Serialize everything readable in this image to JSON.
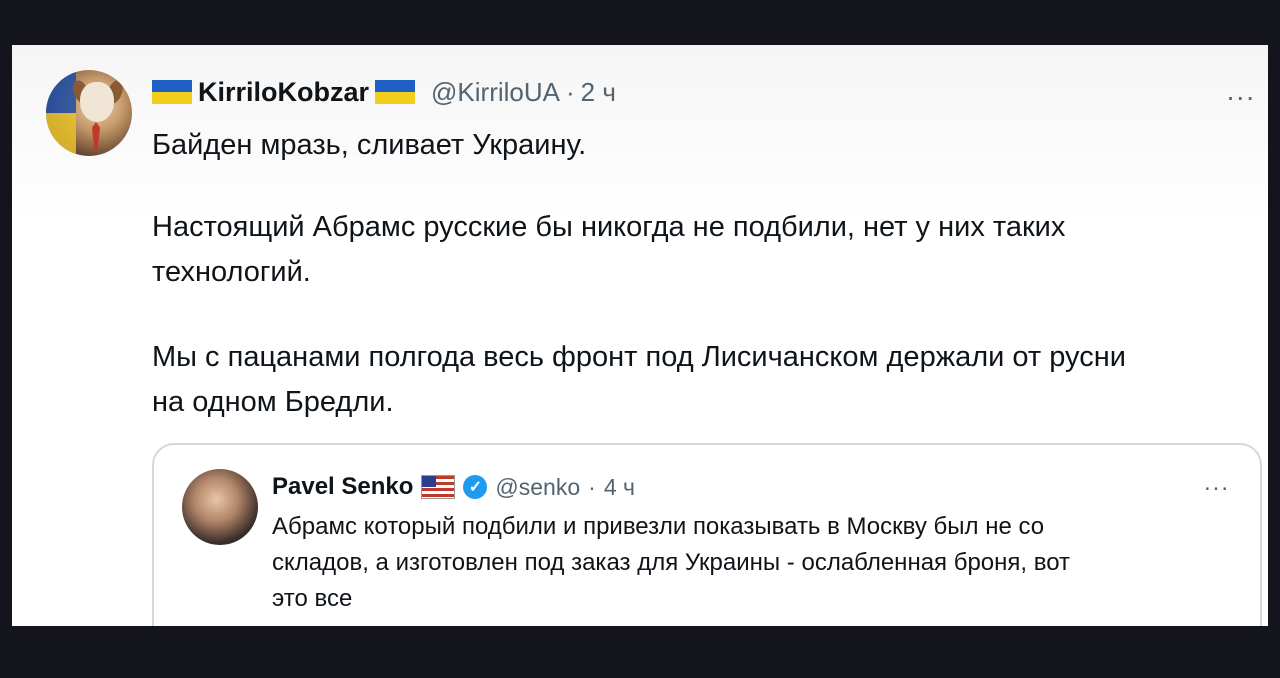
{
  "tweet": {
    "display_name": "KirriloKobzar",
    "handle": "@KirriloUA",
    "dot": "·",
    "time": "2 ч",
    "more": "...",
    "paragraphs": [
      "Байден мразь, сливает Украину.",
      "Настоящий Абрамс русские бы никогда не подбили, нет у них таких технологий.",
      "Мы с пацанами полгода весь фронт под Лисичанском держали от русни на одном Бредли."
    ],
    "paragraph_lines": [
      [
        "Байден мразь, сливает Украину."
      ],
      [
        "Настоящий Абрамс русские бы никогда не подбили, нет у них таких",
        "технологий."
      ],
      [
        "Мы с пацанами полгода весь фронт под Лисичанском держали от русни",
        "на одном Бредли."
      ]
    ]
  },
  "quoted": {
    "display_name": "Pavel Senko",
    "handle": "@senko",
    "dot": "·",
    "time": "4 ч",
    "more": "...",
    "lines": [
      "Абрамс который подбили и привезли показывать в Москву был не со",
      "складов, а изготовлен под заказ для Украины - ослабленная броня, вот",
      "это все"
    ]
  },
  "colors": {
    "text": "#0f1419",
    "secondary": "#536471",
    "verified": "#1d9bf0",
    "ua_blue": "#1f5fc4",
    "ua_yellow": "#f2cf1c"
  }
}
